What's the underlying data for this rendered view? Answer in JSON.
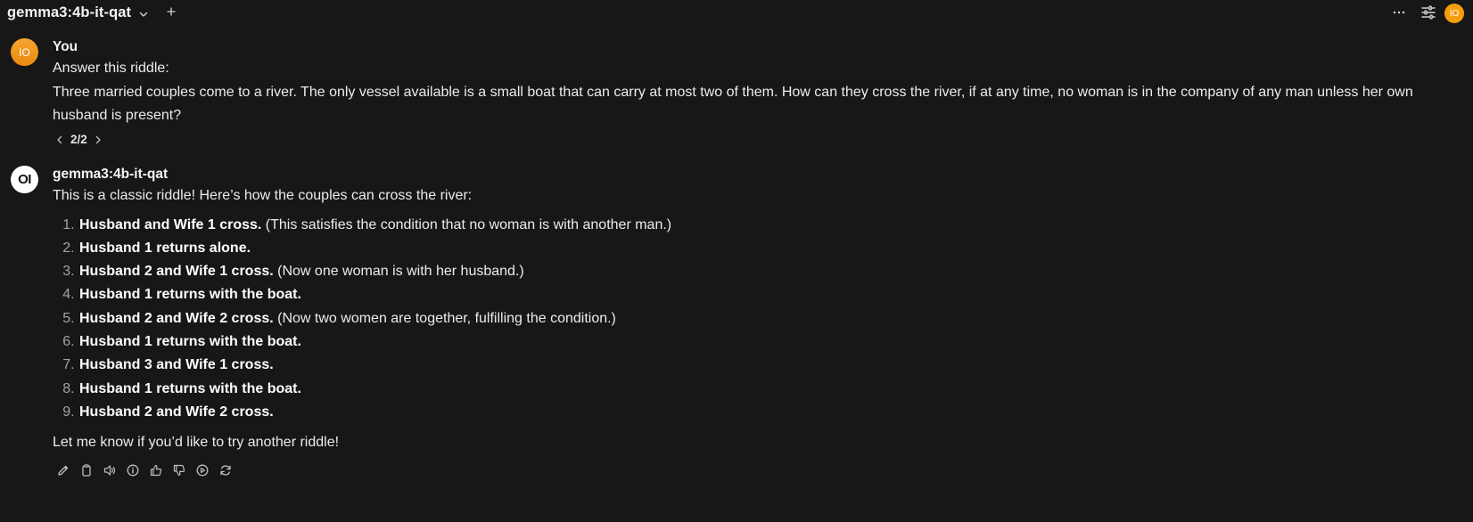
{
  "header": {
    "model_name": "gemma3:4b-it-qat",
    "user_initials": "IO",
    "icons": {
      "model_dropdown": "chevron-down-icon",
      "new_chat": "plus-icon",
      "more": "ellipsis-icon",
      "controls": "sliders-icon"
    }
  },
  "messages": [
    {
      "role": "user",
      "avatar_initials": "IO",
      "sender": "You",
      "lines": [
        "Answer this riddle:",
        "Three married couples come to a river. The only vessel available is a small boat that can carry at most two of them. How can they cross the river, if at any time, no woman is in the company of any man unless her own husband is present?"
      ],
      "pager": "2/2"
    },
    {
      "role": "assistant",
      "avatar_initials": "OI",
      "sender": "gemma3:4b-it-qat",
      "intro": "This is a classic riddle! Here’s how the couples can cross the river:",
      "steps": [
        {
          "bold": "Husband and Wife 1 cross.",
          "rest": " (This satisfies the condition that no woman is with another man.)"
        },
        {
          "bold": "Husband 1 returns alone.",
          "rest": ""
        },
        {
          "bold": "Husband 2 and Wife 1 cross.",
          "rest": " (Now one woman is with her husband.)"
        },
        {
          "bold": "Husband 1 returns with the boat.",
          "rest": ""
        },
        {
          "bold": "Husband 2 and Wife 2 cross.",
          "rest": " (Now two women are together, fulfilling the condition.)"
        },
        {
          "bold": "Husband 1 returns with the boat.",
          "rest": ""
        },
        {
          "bold": "Husband 3 and Wife 1 cross.",
          "rest": ""
        },
        {
          "bold": "Husband 1 returns with the boat.",
          "rest": ""
        },
        {
          "bold": "Husband 2 and Wife 2 cross.",
          "rest": ""
        }
      ],
      "closing": "Let me know if you’d like to try another riddle!",
      "action_icons": [
        "edit-icon",
        "copy-icon",
        "speaker-icon",
        "info-icon",
        "thumbs-up-icon",
        "thumbs-down-icon",
        "continue-icon",
        "regenerate-icon"
      ]
    }
  ],
  "colors": {
    "background": "#171717",
    "text": "#ececec",
    "user_avatar": "#f59e0b",
    "assistant_avatar": "#ffffff"
  }
}
